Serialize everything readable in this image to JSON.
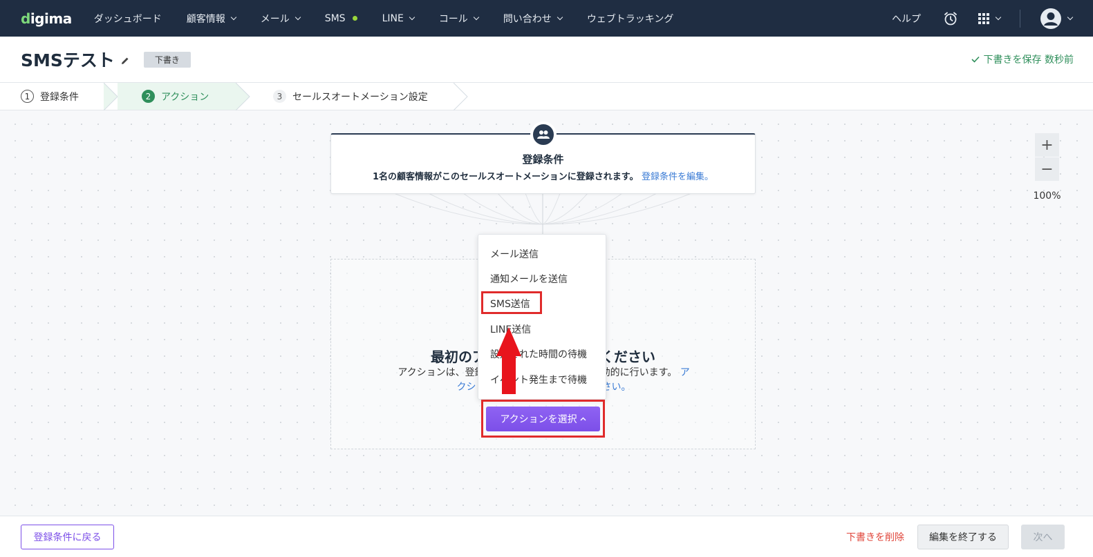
{
  "nav": {
    "logo": "digima",
    "items": [
      {
        "label": "ダッシュボード",
        "has_menu": false
      },
      {
        "label": "顧客情報",
        "has_menu": true
      },
      {
        "label": "メール",
        "has_menu": true
      },
      {
        "label": "SMS",
        "has_menu": false,
        "status_dot": "#9ad63b"
      },
      {
        "label": "LINE",
        "has_menu": true
      },
      {
        "label": "コール",
        "has_menu": true
      },
      {
        "label": "問い合わせ",
        "has_menu": true
      },
      {
        "label": "ウェブトラッキング",
        "has_menu": false
      }
    ],
    "help_label": "ヘルプ",
    "icons": [
      "alarm-clock-icon",
      "apps-grid-icon",
      "user-avatar-icon"
    ]
  },
  "header": {
    "title": "SMSテスト",
    "status_badge": "下書き",
    "saved_text": "下書きを保存 数秒前"
  },
  "steps": [
    {
      "num": "1",
      "label": "登録条件"
    },
    {
      "num": "2",
      "label": "アクション"
    },
    {
      "num": "3",
      "label": "セールスオートメーション設定"
    }
  ],
  "trigger": {
    "title": "登録条件",
    "desc": "1名の顧客情報がこのセールスオートメーションに登録されます。",
    "edit_link": "登録条件を編集。"
  },
  "empty_state": {
    "title_left": "最初のア",
    "title_right": "ください",
    "desc_line1_left": "アクションは、登録",
    "desc_line1_right": "動的に行います。",
    "desc_line1_link": "ア",
    "desc_line2_left": "クショ",
    "desc_line2_right": "さい。"
  },
  "dropdown": {
    "items": [
      "メール送信",
      "通知メールを送信",
      "SMS送信",
      "LINE送信",
      "設定された時間の待機",
      "イベント発生まで待機"
    ],
    "highlighted": "SMS送信"
  },
  "action_button": "アクションを選択",
  "zoom": {
    "in": "+",
    "out": "−",
    "level": "100%"
  },
  "footer": {
    "back": "登録条件に戻る",
    "delete_draft": "下書きを削除",
    "finish_edit": "編集を終了する",
    "next": "次へ"
  },
  "colors": {
    "nav_bg": "#1f2d42",
    "accent_green": "#2f8f5b",
    "primary_purple": "#7c4fe8",
    "highlight_red": "#e02b2b",
    "link_blue": "#3a7bd5"
  }
}
